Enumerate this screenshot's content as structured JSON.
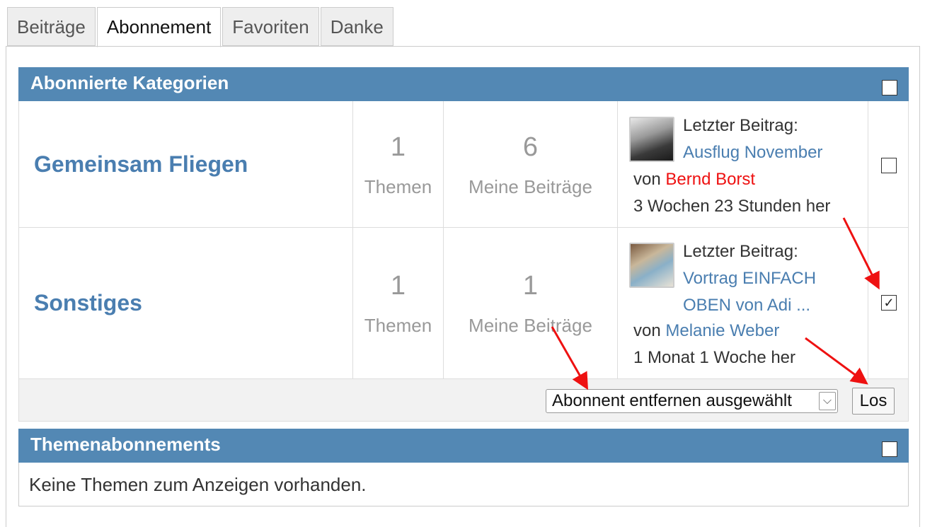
{
  "tabs": [
    {
      "label": "Beiträge",
      "active": false
    },
    {
      "label": "Abonnement",
      "active": true
    },
    {
      "label": "Favoriten",
      "active": false
    },
    {
      "label": "Danke",
      "active": false
    }
  ],
  "categories_section": {
    "title": "Abonnierte Kategorien",
    "rows": [
      {
        "name": "Gemeinsam Fliegen",
        "topics": "1",
        "topics_label": "Themen",
        "posts": "6",
        "posts_label": "Meine Beiträge",
        "last_label": "Letzter Beitrag:",
        "last_title": "Ausflug November",
        "by": "von",
        "author": "Bernd Borst",
        "time": "3 Wochen 23 Stunden her",
        "checked": false
      },
      {
        "name": "Sonstiges",
        "topics": "1",
        "topics_label": "Themen",
        "posts": "1",
        "posts_label": "Meine Beiträge",
        "last_label": "Letzter Beitrag:",
        "last_title": "Vortrag EINFACH OBEN von Adi ...",
        "by": "von",
        "author": "Melanie Weber",
        "time": "1 Monat 1 Woche her",
        "checked": true
      }
    ],
    "action_select": "Abonnent entfernen ausgewählt",
    "go_label": "Los"
  },
  "topics_section": {
    "title": "Themenabonnements",
    "empty_text": "Keine Themen zum Anzeigen vorhanden."
  },
  "colors": {
    "header_bg": "#5388b4",
    "link": "#4a7eb0",
    "author_red": "#ee1111",
    "annotation_arrow": "#ee1111"
  },
  "icons": {
    "select_arrow": "chevron-down-icon",
    "checked_mark": "checkmark-icon"
  }
}
